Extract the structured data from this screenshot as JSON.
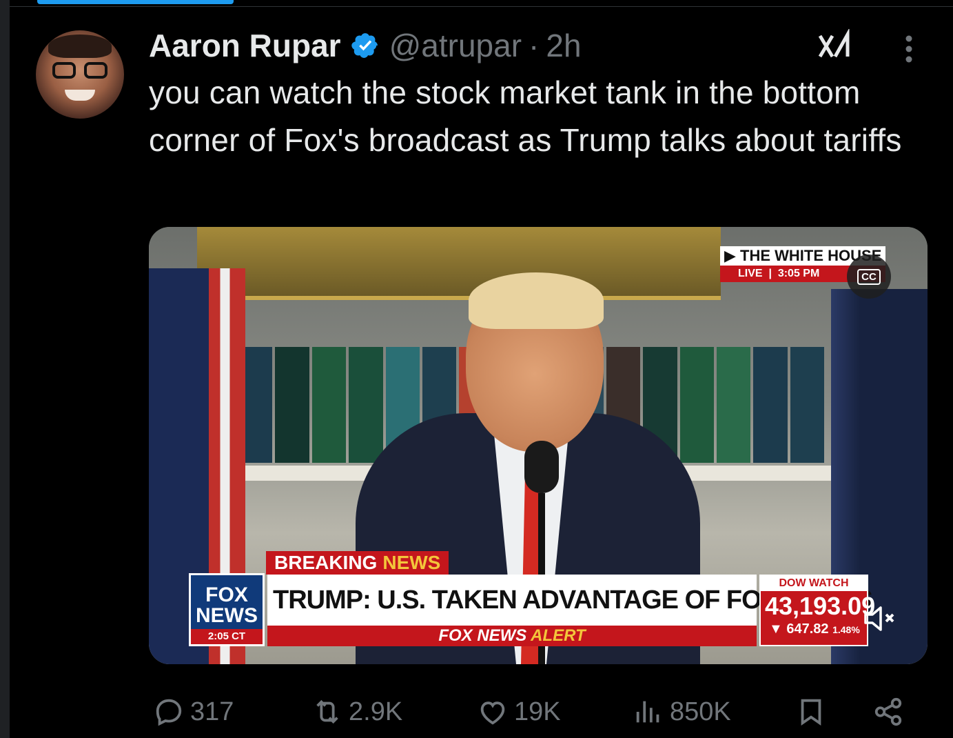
{
  "tweet": {
    "author_name": "Aaron Rupar",
    "handle": "@atrupar",
    "separator": "·",
    "time": "2h",
    "text": "you can watch the stock market tank in the bottom corner of Fox's broadcast as Trump talks about tariffs"
  },
  "video": {
    "network_bug": {
      "location": "THE WHITE HOUSE",
      "live": "LIVE",
      "time": "3:05 PM"
    },
    "cc_label": "CC",
    "breaking_news": {
      "word1": "BREAKING",
      "word2": "NEWS"
    },
    "logo": {
      "line1": "FOX",
      "line2": "NEWS",
      "clock": "2:05 CT"
    },
    "headline": "TRUMP: U.S. TAKEN ADVANTAGE OF FOR YEARS",
    "alert": {
      "brand": "FOX NEWS",
      "word": "ALERT"
    },
    "dow_watch": {
      "label": "DOW WATCH",
      "value": "43,193.09",
      "change": "647.82",
      "percent": "1.48%"
    }
  },
  "actions": {
    "replies": "317",
    "reposts": "2.9K",
    "likes": "19K",
    "views": "850K"
  },
  "colors": {
    "accent": "#1d9bf0",
    "muted_text": "#71767b",
    "fox_red": "#c4161c"
  }
}
